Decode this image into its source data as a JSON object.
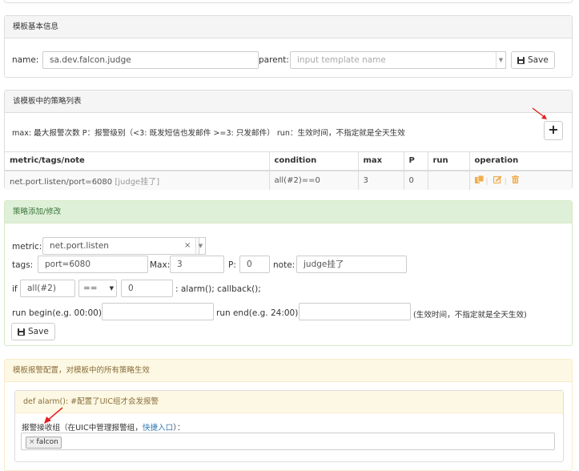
{
  "basic_panel": {
    "heading": "模板基本信息",
    "name_label": "name:",
    "name_value": "sa.dev.falcon.judge",
    "parent_label": "parent:",
    "parent_placeholder": "input template name",
    "save_label": "Save"
  },
  "strategy_panel": {
    "heading": "该模板中的策略列表",
    "hint": "max: 最大报警次数 P：报警级别（<3: 既发短信也发邮件 >=3: 只发邮件） run：生效时间，不指定就是全天生效",
    "add_button": "+",
    "table": {
      "headers": [
        "metric/tags/note",
        "condition",
        "max",
        "P",
        "run",
        "operation"
      ],
      "rows": [
        {
          "metric": "net.port.listen/port=6080",
          "note": "[judge挂了]",
          "condition": "all(#2)==0",
          "max": "3",
          "p": "0",
          "run": ""
        }
      ]
    },
    "op_icons": [
      "copy-icon",
      "edit-icon",
      "trash-icon"
    ]
  },
  "edit_panel": {
    "heading": "策略添加/修改",
    "metric_label": "metric:",
    "metric_value": "net.port.listen",
    "clear_glyph": "×",
    "tags_label": "tags:",
    "tags_value": "port=6080",
    "max_label": "Max:",
    "max_value": "3",
    "p_label": "P:",
    "p_value": "0",
    "note_label": "note:",
    "note_value": "judge挂了",
    "if_label": "if",
    "func_value": "all(#2)",
    "operator_value": "==",
    "threshold_value": "0",
    "callback_text": ": alarm(); callback();",
    "run_begin_label": "run begin(e.g. 00:00):",
    "run_end_label": "run end(e.g. 24:00):",
    "run_hint": "(生效时间，不指定就是全天生效)",
    "save_label": "Save"
  },
  "alarm_panel": {
    "heading": "模板报警配置，对模板中的所有策略生效",
    "sub_heading": "def alarm(): #配置了UIC组才会发报警",
    "receiver_label_prefix": "报警接收组（在UIC中管理报警组，",
    "receiver_link": "快捷入口",
    "receiver_label_suffix": "）：",
    "tag_x": "×",
    "tag_value": "falcon"
  },
  "colors": {
    "success_bg": "#dff0d8",
    "warning_bg": "#fcf8e3",
    "annotation_red": "#e02020",
    "op_orange": "#f0ad4e"
  }
}
